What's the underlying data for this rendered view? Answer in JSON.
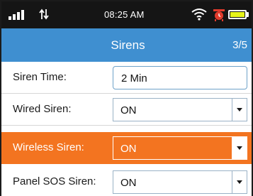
{
  "status_bar": {
    "time": "08:25 AM",
    "signal_icon": "signal-bars-icon",
    "data_icon": "data-transfer-icon",
    "wifi_icon": "wifi-icon",
    "alarm_icon": "alarm-clock-icon",
    "battery_icon": "battery-icon",
    "battery_level": 1.0,
    "battery_fill_color": "#e7f51a"
  },
  "header": {
    "title": "Sirens",
    "page_indicator": "3/5",
    "background_color": "#3f8fd0"
  },
  "settings": {
    "siren_time": {
      "label": "Siren Time:",
      "value": "2 Min"
    },
    "wired_siren": {
      "label": "Wired Siren:",
      "value": "ON"
    },
    "wireless_siren": {
      "label": "Wireless Siren:",
      "value": "ON",
      "highlight_color": "#f37420"
    },
    "panel_sos_siren": {
      "label": "Panel SOS Siren:",
      "value": "ON"
    }
  }
}
